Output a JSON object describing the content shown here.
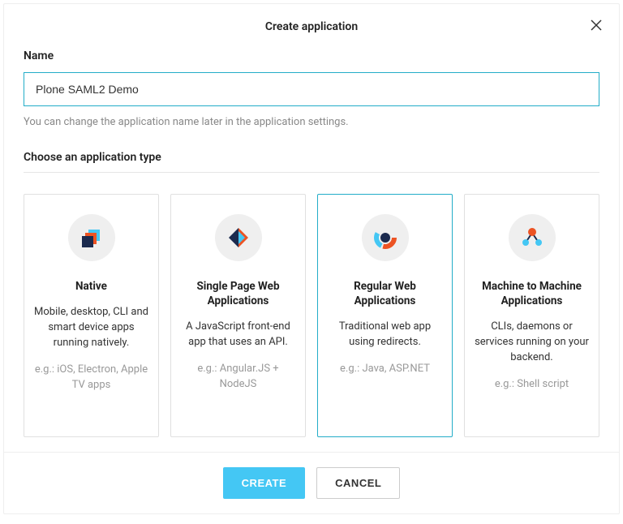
{
  "modal": {
    "title": "Create application",
    "close_icon": "close-icon"
  },
  "nameField": {
    "label": "Name",
    "value": "Plone SAML2 Demo",
    "hint": "You can change the application name later in the application settings."
  },
  "typeSection": {
    "label": "Choose an application type",
    "selectedIndex": 2,
    "cards": [
      {
        "icon": "native-icon",
        "title": "Native",
        "desc": "Mobile, desktop, CLI and smart device apps running natively.",
        "eg": "e.g.: iOS, Electron, Apple TV apps"
      },
      {
        "icon": "spa-icon",
        "title": "Single Page Web Applications",
        "desc": "A JavaScript front-end app that uses an API.",
        "eg": "e.g.: Angular.JS + NodeJS"
      },
      {
        "icon": "regular-web-icon",
        "title": "Regular Web Applications",
        "desc": "Traditional web app using redirects.",
        "eg": "e.g.: Java, ASP.NET"
      },
      {
        "icon": "m2m-icon",
        "title": "Machine to Machine Applications",
        "desc": "CLIs, daemons or services running on your backend.",
        "eg": "e.g.: Shell script"
      }
    ]
  },
  "footer": {
    "create_label": "Create",
    "cancel_label": "Cancel"
  }
}
